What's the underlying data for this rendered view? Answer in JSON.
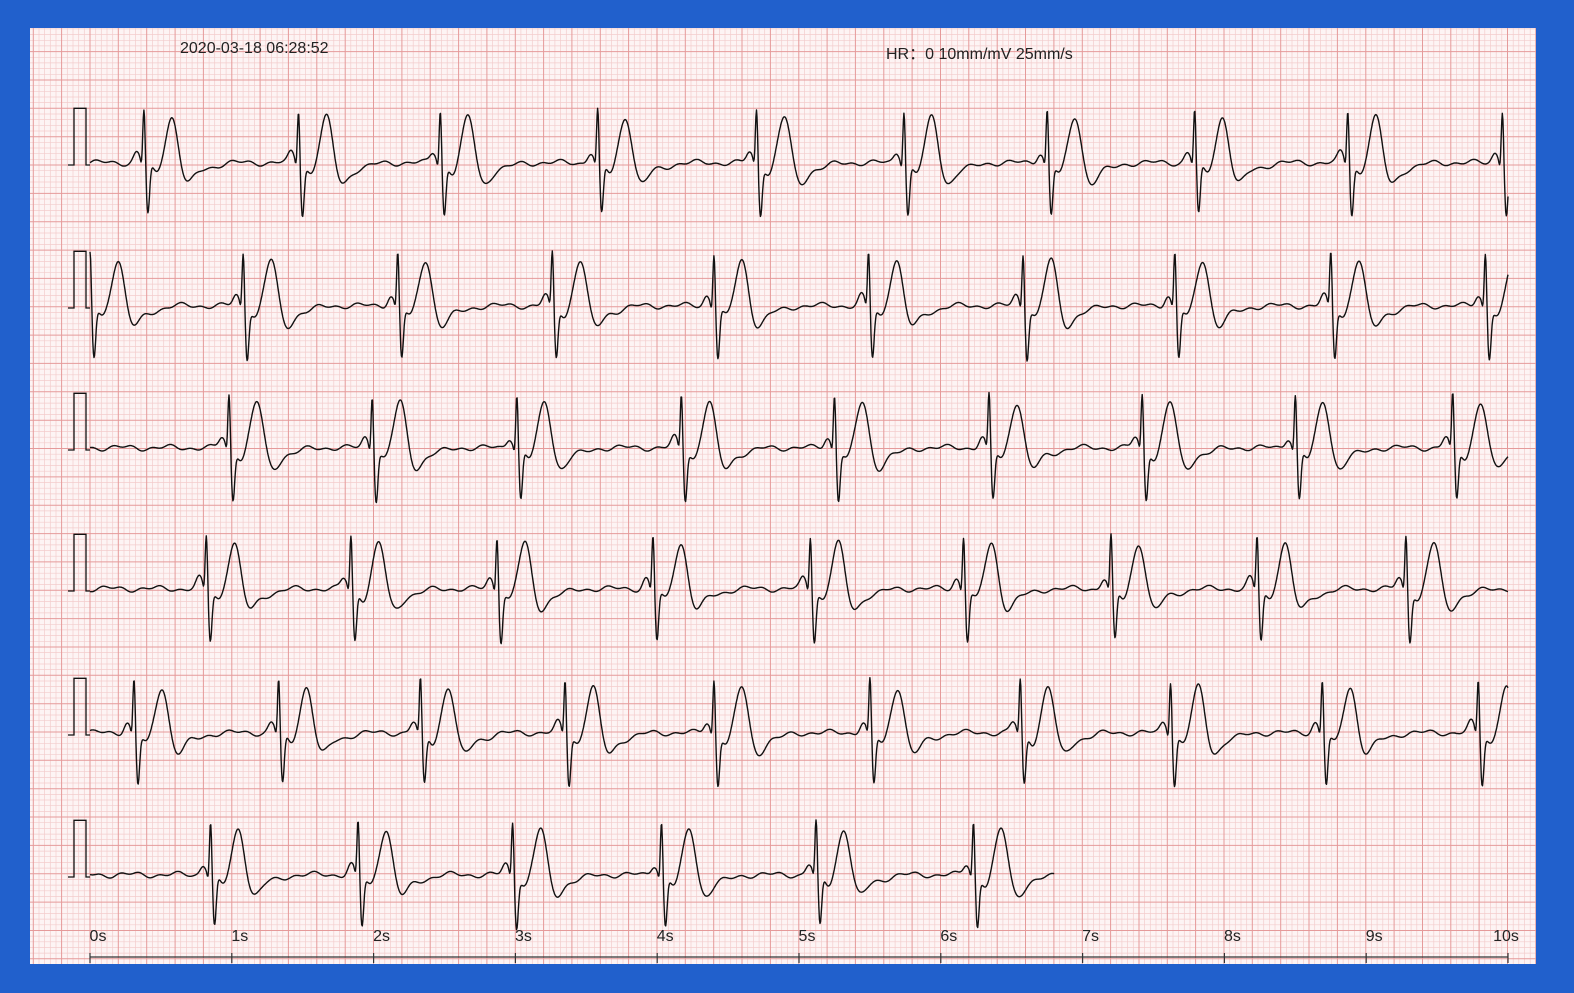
{
  "header": {
    "timestamp": "2020-03-18 06:28:52",
    "hr_label": "HR：",
    "hr_value": "0",
    "gain": "10mm/mV",
    "speed": "25mm/s"
  },
  "colors": {
    "frame": "#2160cc",
    "paper": "#fdf4f4",
    "grid_minor": "#f3cccc",
    "grid_major": "#e59a9a",
    "trace": "#111111"
  },
  "chart_data": {
    "type": "line",
    "title": "",
    "xlabel": "",
    "ylabel": "",
    "x_unit": "s",
    "xlim": [
      0,
      10
    ],
    "x_ticks": [
      "0s",
      "1s",
      "2s",
      "3s",
      "4s",
      "5s",
      "6s",
      "7s",
      "8s",
      "9s",
      "10s"
    ],
    "grid": true,
    "calibration_pulse_mV": 1.0,
    "leads": [
      {
        "row": 1,
        "duration_s": 10.0,
        "beat_times_s": [
          0.38,
          1.47,
          2.47,
          3.58,
          4.7,
          5.74,
          6.75,
          7.79,
          8.87,
          9.96
        ]
      },
      {
        "row": 2,
        "duration_s": 10.0,
        "beat_times_s": [
          0.0,
          1.08,
          2.17,
          3.26,
          4.4,
          5.49,
          6.58,
          7.65,
          8.75,
          9.84
        ]
      },
      {
        "row": 3,
        "duration_s": 10.0,
        "beat_times_s": [
          0.98,
          1.99,
          3.01,
          4.17,
          5.25,
          6.34,
          7.42,
          8.5,
          9.61
        ]
      },
      {
        "row": 4,
        "duration_s": 10.0,
        "beat_times_s": [
          0.82,
          1.84,
          2.87,
          3.97,
          5.08,
          6.16,
          7.2,
          8.23,
          9.28
        ]
      },
      {
        "row": 5,
        "duration_s": 10.0,
        "beat_times_s": [
          0.31,
          1.33,
          2.33,
          3.35,
          4.4,
          5.5,
          6.56,
          7.62,
          8.69,
          9.79
        ]
      },
      {
        "row": 6,
        "duration_s": 6.8,
        "beat_times_s": [
          0.85,
          1.89,
          2.98,
          4.03,
          5.12,
          6.23
        ]
      }
    ]
  }
}
